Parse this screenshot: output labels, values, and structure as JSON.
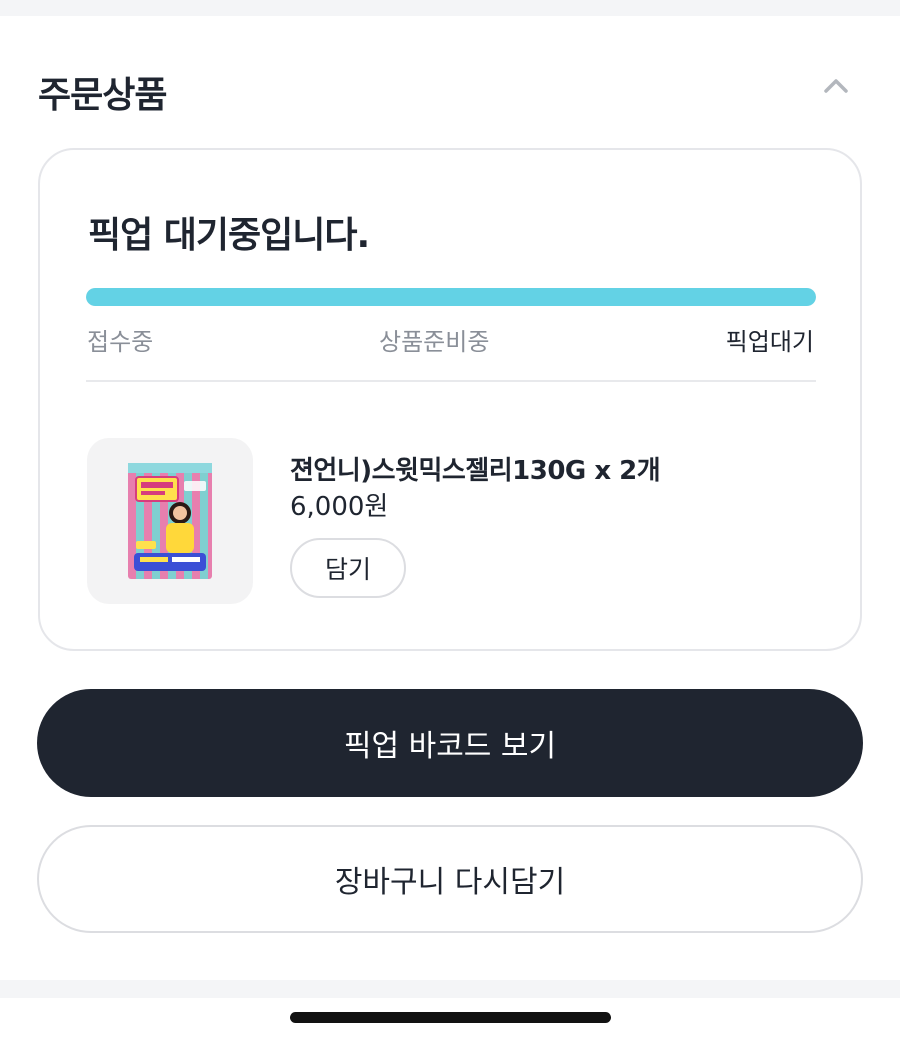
{
  "section": {
    "title": "주문상품",
    "collapse_icon": "chevron-up-icon"
  },
  "order": {
    "status_headline": "픽업 대기중입니다.",
    "progress": {
      "fraction": 1.0,
      "color": "#63d2e5",
      "steps": [
        "접수중",
        "상품준비중",
        "픽업대기"
      ],
      "current_step": 2
    },
    "item": {
      "image_icon": "jelly-package-image",
      "name": "젼언니)스윗믹스젤리130G x 2개",
      "price": "6,000원",
      "add_label": "담기"
    }
  },
  "actions": {
    "barcode_label": "픽업 바코드 보기",
    "recart_label": "장바구니 다시담기"
  },
  "colors": {
    "primary_dark": "#1f2530",
    "accent": "#63d2e5"
  }
}
